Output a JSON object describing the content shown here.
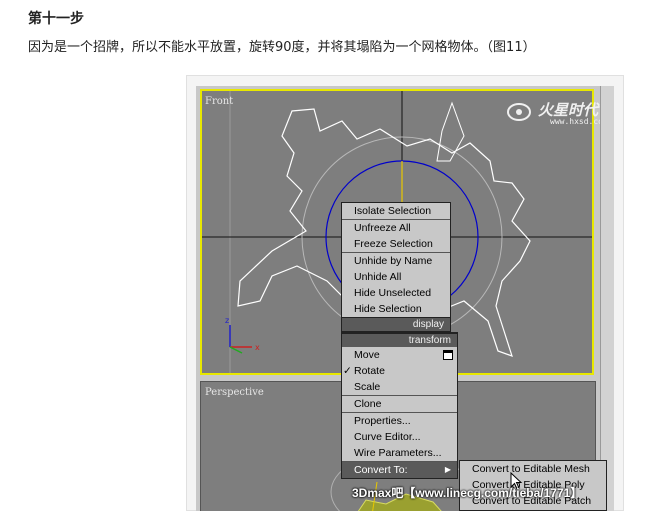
{
  "article": {
    "step_title": "第十一步",
    "step_desc": "因为是一个招牌，所以不能水平放置，旋转90度，并将其塌陷为一个网格物体。（图11）"
  },
  "viewports": {
    "front_label": "Front",
    "persp_label": "Perspective",
    "axis_z": "z",
    "axis_x": "x"
  },
  "watermark": {
    "brand": "火星时代",
    "url": "www.hxsd.com"
  },
  "quad_menu_top": {
    "items": [
      "Isolate Selection",
      "Unfreeze All",
      "Freeze Selection",
      "Unhide by Name",
      "Unhide All",
      "Hide Unselected",
      "Hide Selection"
    ],
    "header": "display"
  },
  "quad_menu_bottom": {
    "header": "transform",
    "items": [
      "Move",
      "Rotate",
      "Scale",
      "Clone",
      "Properties...",
      "Curve Editor...",
      "Wire Parameters...",
      "Convert To:"
    ],
    "checked": "Rotate"
  },
  "submenu": {
    "items": [
      "Convert to Editable Mesh",
      "Convert to Editable Poly",
      "Convert to Editable Patch"
    ]
  },
  "footer_watermark": "3Dmax吧【www.linecg.com/tieba/1771】",
  "colors": {
    "viewport_bg": "#7e7e7e",
    "active_border": "#e8e800",
    "menu_bg": "#c8c8c8",
    "menu_header_bg": "#5a5a5a",
    "gizmo_blue": "#0000cc"
  }
}
